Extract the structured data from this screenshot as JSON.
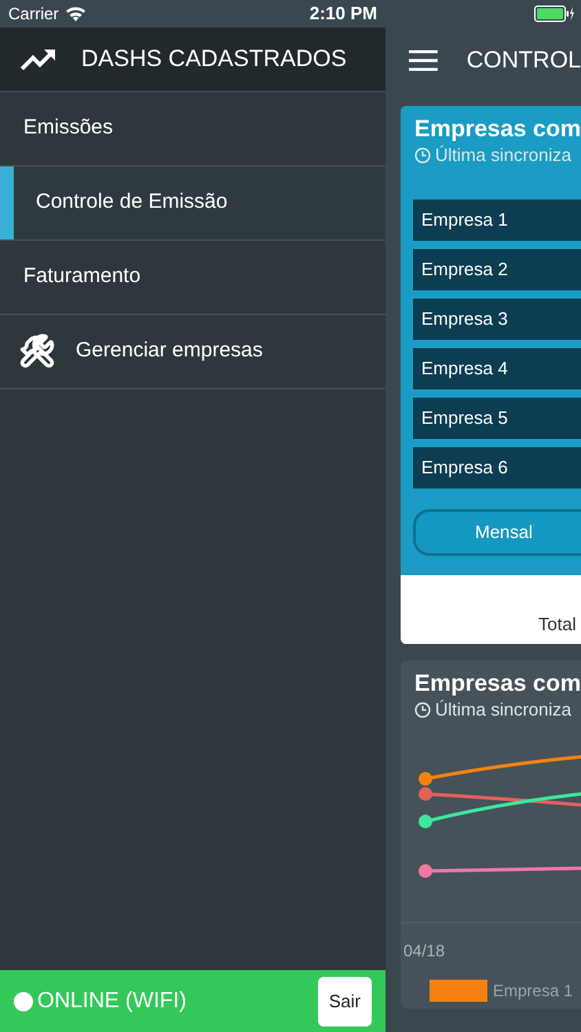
{
  "status_bar": {
    "carrier": "Carrier",
    "time": "2:10 PM"
  },
  "sidebar": {
    "title": "DASHS CADASTRADOS",
    "items": [
      {
        "label": "Emissões",
        "kind": "group",
        "selected": false
      },
      {
        "label": "Controle de Emissão",
        "kind": "subitem",
        "selected": true
      },
      {
        "label": "Faturamento",
        "kind": "group",
        "selected": false
      },
      {
        "label": "Gerenciar empresas",
        "kind": "action",
        "selected": false
      }
    ],
    "connection": {
      "label": "ONLINE (WIFI)",
      "online": true
    },
    "logout_button": "Sair"
  },
  "header": {
    "title": "CONTROL"
  },
  "cards": [
    {
      "title": "Empresas com",
      "sync": "Última sincroniza",
      "companies": [
        "Empresa 1",
        "Empresa 2",
        "Empresa 3",
        "Empresa 4",
        "Empresa 5",
        "Empresa 6"
      ],
      "period_button": "Mensal",
      "total_label": "Total"
    },
    {
      "title": "Empresas com",
      "sync": "Última sincroniza",
      "x_label": "04/18",
      "legend": [
        {
          "label": "Empresa 1",
          "color": "#f5820f"
        }
      ]
    }
  ]
}
